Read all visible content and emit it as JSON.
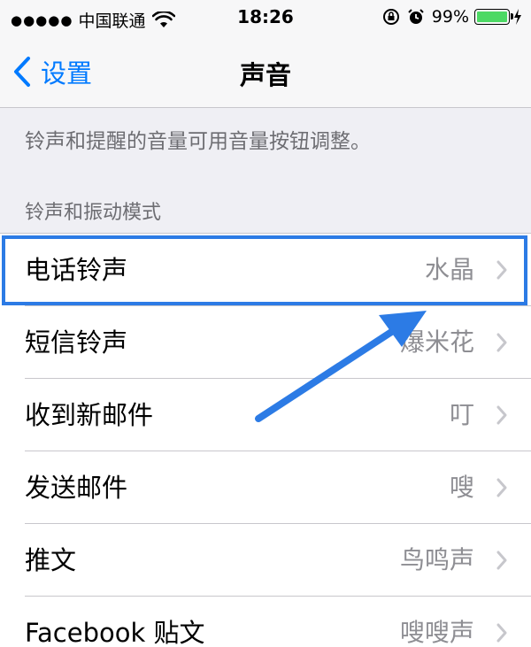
{
  "status_bar": {
    "signal_dots": "●●●●●",
    "carrier": "中国联通",
    "time": "18:26",
    "battery_percent": "99%",
    "icons": [
      "wifi-icon",
      "orientation-lock-icon",
      "alarm-icon",
      "battery-icon",
      "charging-icon"
    ]
  },
  "nav": {
    "back_label": "设置",
    "title": "声音"
  },
  "info_text": "铃声和提醒的音量可用音量按钮调整。",
  "section_header": "铃声和振动模式",
  "rows": [
    {
      "label": "电话铃声",
      "value": "水晶"
    },
    {
      "label": "短信铃声",
      "value": "爆米花"
    },
    {
      "label": "收到新邮件",
      "value": "叮"
    },
    {
      "label": "发送邮件",
      "value": "嗖"
    },
    {
      "label": "推文",
      "value": "鸟鸣声"
    },
    {
      "label": "Facebook 贴文",
      "value": "嗖嗖声"
    }
  ],
  "colors": {
    "accent": "#007aff",
    "highlight": "#2c7be5",
    "battery": "#4cd964",
    "secondary_text": "#8e8e93"
  }
}
